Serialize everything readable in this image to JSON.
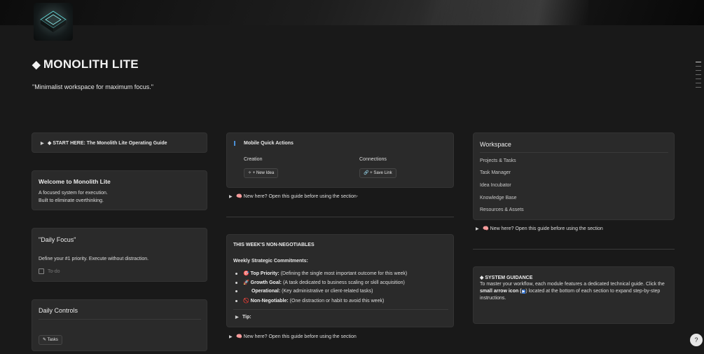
{
  "page": {
    "title": "MONOLITH LITE",
    "title_icon": "◆",
    "quote": "\"Minimalist workspace for maximum focus.\""
  },
  "start_card": {
    "arrow": "▶",
    "label": "◆ START HERE: The Monolith Lite Operating Guide"
  },
  "welcome_card": {
    "title": "Welcome to Monolith Lite",
    "line1": "A focused system for execution.",
    "line2": "Built to eliminate overthinking."
  },
  "focus_card": {
    "title": "\"Daily Focus\"",
    "desc": "Define your #1 priority. Execute without distraction.",
    "todo_placeholder": "To-do"
  },
  "controls_card": {
    "title": "Daily Controls",
    "tasks_button": "Tasks"
  },
  "quick_actions": {
    "title": "Mobile Quick Actions",
    "creation_label": "Creation",
    "connections_label": "Connections",
    "new_idea_button": "+ New Idea",
    "save_link_button": "+ Save Link"
  },
  "middle_guide_1": {
    "arrow": "▶",
    "text": "🧠 New here? Open this guide before using the section-"
  },
  "non_negotiables": {
    "title": "THIS WEEK'S NON-NEGOTIABLES",
    "subtitle": "Weekly Strategic Commitments:",
    "items": [
      {
        "icon": "🎯",
        "label": "Top Priority:",
        "text": " (Defining the single most important outcome for this week)"
      },
      {
        "icon": "🚀",
        "label": "Growth Goal:",
        "text": " (A task dedicated to business scaling or skill acquisition)"
      },
      {
        "icon": "",
        "label": "Operational:",
        "text": " (Key administrative or client-related tasks)"
      },
      {
        "icon": "🚫",
        "label": "Non-Negotiable:",
        "text": " (One distraction or habit to avoid this week)"
      }
    ],
    "tip": "Tip:"
  },
  "middle_guide_2": {
    "arrow": "▶",
    "text": "🧠 New here? Open this guide before using the section"
  },
  "workspace": {
    "title": "Workspace",
    "links": [
      "Projects & Tasks",
      "Task Manager",
      "Idea Incubator",
      "Knowledge Base",
      "Resources & Assets"
    ]
  },
  "right_guide": {
    "arrow": "▶",
    "text": "🧠 New here? Open this guide before using the section"
  },
  "system_guidance": {
    "title": "◆ SYSTEM GUIDANCE",
    "line1": "To master your workflow, each module features a dedicated technical guide. Click the",
    "bold": "small arrow icon (",
    "arrow_glyph": "▶",
    "line2_rest": ") located at the bottom of each section to expand step-by-step",
    "line3": "instructions."
  },
  "help": {
    "label": "?"
  }
}
